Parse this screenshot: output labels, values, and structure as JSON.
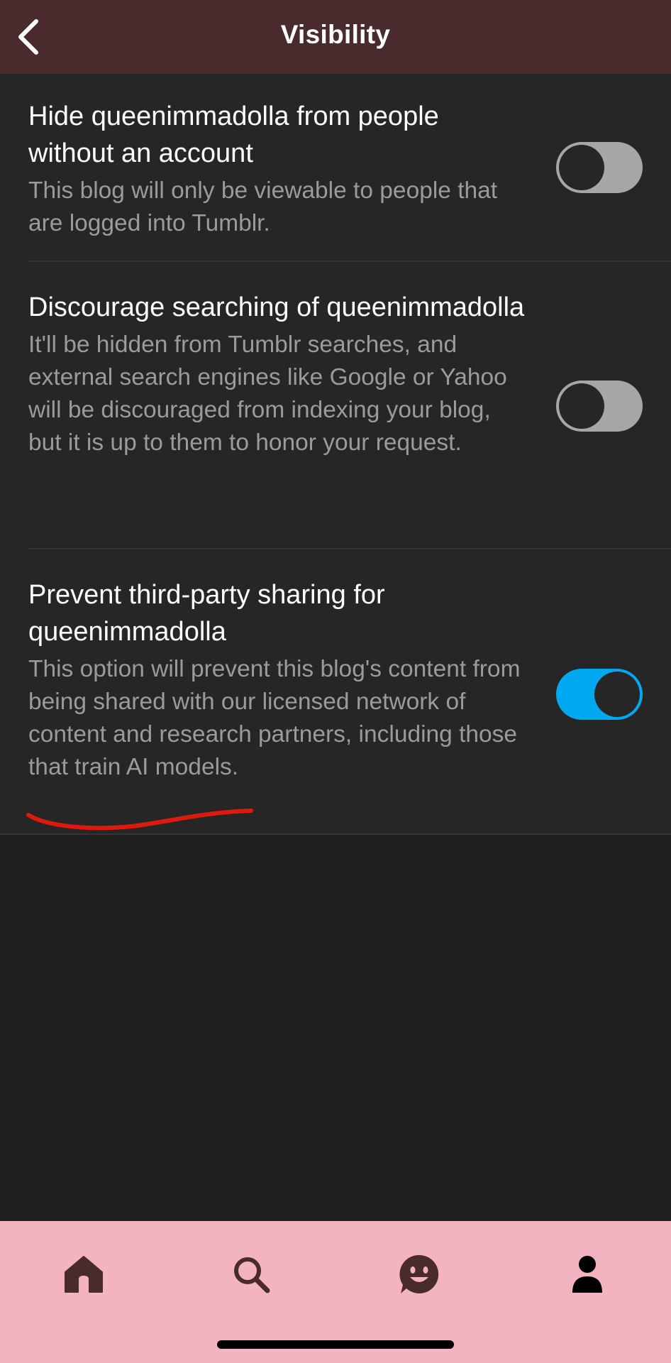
{
  "header": {
    "title": "Visibility",
    "back_icon": "chevron-left-icon"
  },
  "settings": [
    {
      "title": "Hide queenimmadolla from people without an account",
      "description": "This blog will only be viewable to people that are logged into Tumblr.",
      "enabled": false
    },
    {
      "title": "Discourage searching of queenimmadolla",
      "description": "It'll be hidden from Tumblr searches, and external search engines like Google or Yahoo will be discouraged from indexing your blog, but it is up to them to honor your request.",
      "enabled": false
    },
    {
      "title": "Prevent third-party sharing for queenimmadolla",
      "description": "This option will prevent this blog's content from being shared with our licensed network of content and research partners, including those that train AI models.",
      "enabled": true
    }
  ],
  "tab_bar": {
    "tabs": [
      "home-icon",
      "search-icon",
      "activity-icon",
      "account-icon"
    ],
    "active": "account-icon"
  },
  "colors": {
    "header_bg": "#4a2b2d",
    "background": "#1f1f1f",
    "list_bg": "#262626",
    "toggle_on": "#00a8ef",
    "toggle_off": "#a6a6a6",
    "tab_bar_bg": "#f4b3c0",
    "tab_icon": "#4a2b2d",
    "tab_icon_active": "#000000",
    "annotation": "#e0190e"
  }
}
